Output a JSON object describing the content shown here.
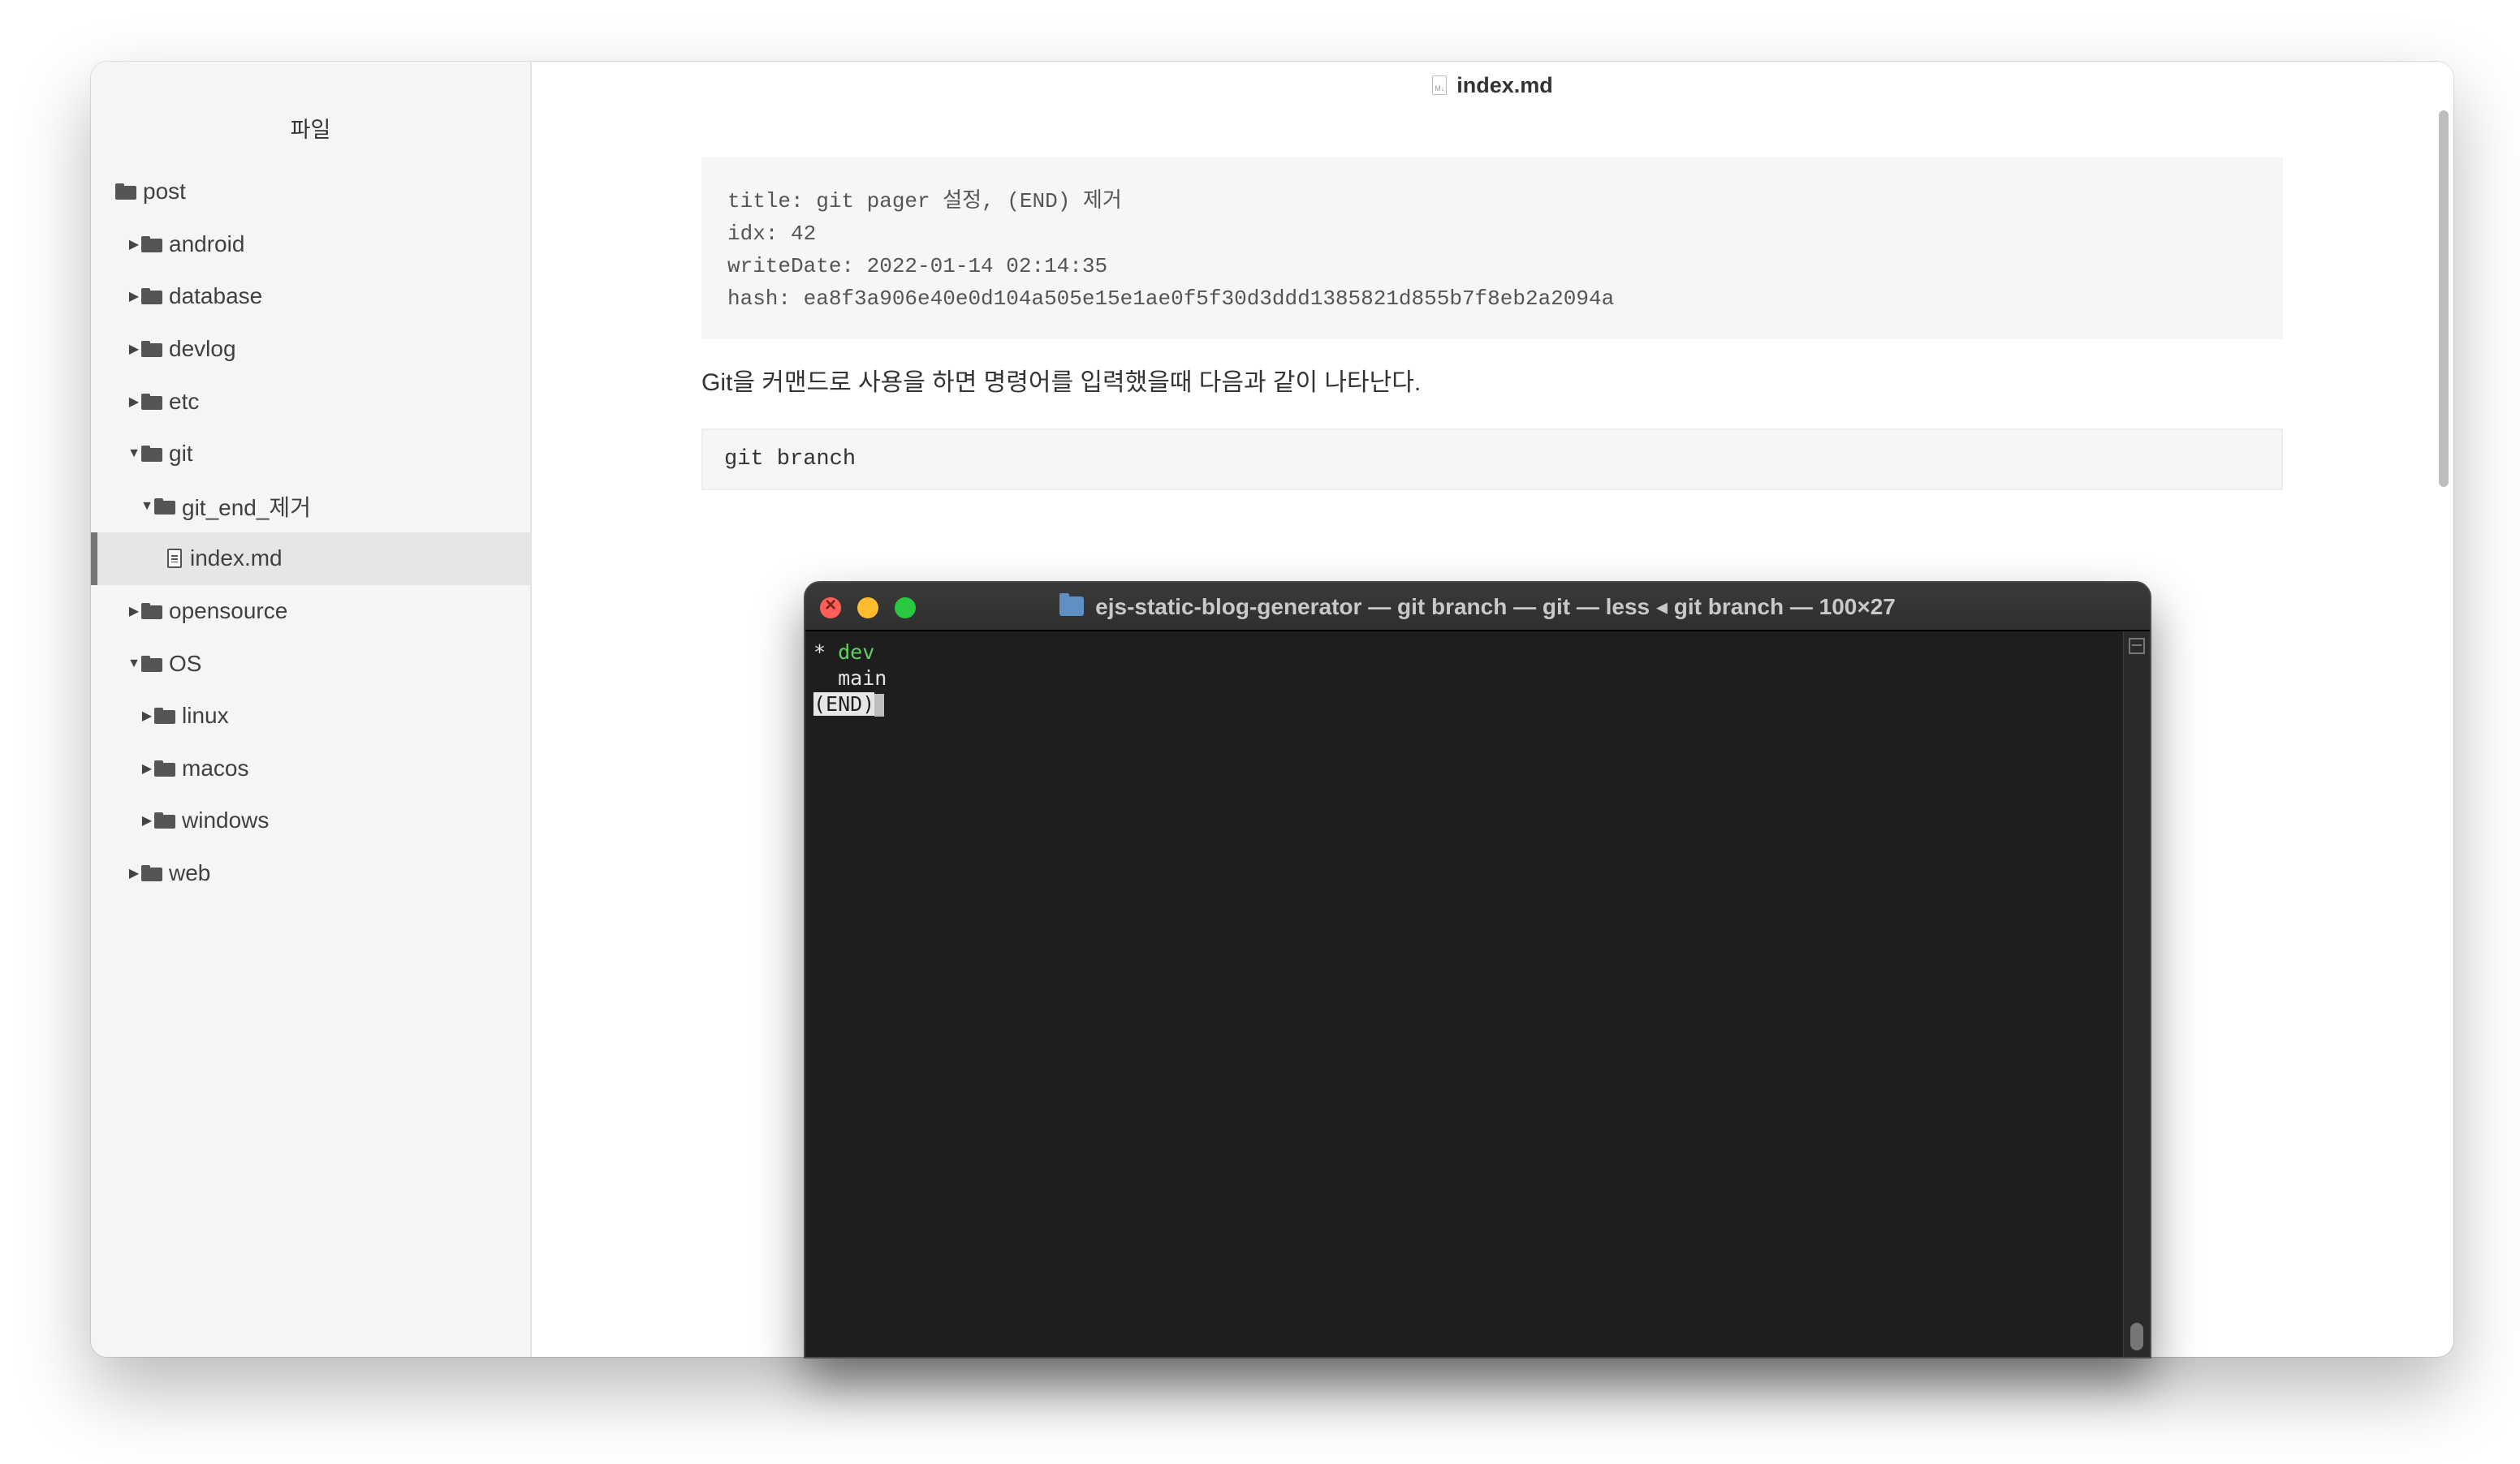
{
  "sidebar": {
    "title": "파일",
    "items": [
      {
        "label": "post",
        "indent": 0,
        "arrow": "none",
        "icon": "folder-icon"
      },
      {
        "label": "android",
        "indent": 1,
        "arrow": "right",
        "icon": "folder-icon"
      },
      {
        "label": "database",
        "indent": 1,
        "arrow": "right",
        "icon": "folder-icon"
      },
      {
        "label": "devlog",
        "indent": 1,
        "arrow": "right",
        "icon": "folder-icon"
      },
      {
        "label": "etc",
        "indent": 1,
        "arrow": "right",
        "icon": "folder-icon"
      },
      {
        "label": "git",
        "indent": 1,
        "arrow": "down",
        "icon": "folder-icon"
      },
      {
        "label": "git_end_제거",
        "indent": 2,
        "arrow": "down",
        "icon": "folder-icon"
      },
      {
        "label": "index.md",
        "indent": 3,
        "arrow": "none",
        "icon": "file-icon",
        "selected": true
      },
      {
        "label": "opensource",
        "indent": 1,
        "arrow": "right",
        "icon": "folder-icon"
      },
      {
        "label": "OS",
        "indent": 1,
        "arrow": "down",
        "icon": "folder-icon"
      },
      {
        "label": "linux",
        "indent": 2,
        "arrow": "right",
        "icon": "folder-icon"
      },
      {
        "label": "macos",
        "indent": 2,
        "arrow": "right",
        "icon": "folder-icon"
      },
      {
        "label": "windows",
        "indent": 2,
        "arrow": "right",
        "icon": "folder-icon"
      },
      {
        "label": "web",
        "indent": 1,
        "arrow": "right",
        "icon": "folder-icon"
      }
    ]
  },
  "editor": {
    "file_title": "index.md",
    "file_icon_label": "M↓",
    "frontmatter": [
      "title: git pager 설정, (END) 제거",
      "idx: 42",
      "writeDate: 2022-01-14 02:14:35",
      "hash: ea8f3a906e40e0d104a505e15e1ae0f5f30d3ddd1385821d855b7f8eb2a2094a"
    ],
    "paragraph": "Git을 커맨드로 사용을 하면 명령어를 입력했을때 다음과 같이 나타난다.",
    "code": "git branch"
  },
  "terminal": {
    "title": "ejs-static-blog-generator — git branch — git — less ◂ git branch — 100×27",
    "lines": {
      "star": "* ",
      "current_branch": "dev",
      "other_branch": "  main",
      "end_marker": "(END)"
    }
  },
  "colors": {
    "accent_green": "#5fd35f",
    "terminal_bg": "#1e1e1e",
    "sidebar_bg": "#f5f5f5"
  }
}
